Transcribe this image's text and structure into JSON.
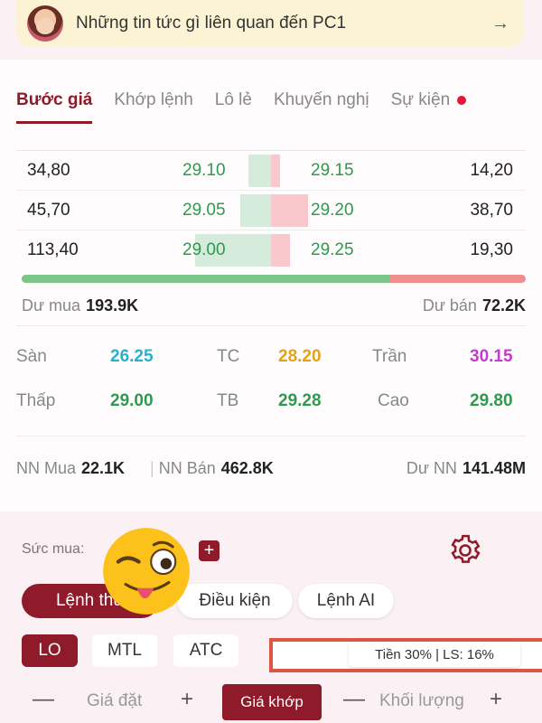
{
  "banner": {
    "text": "Những tin tức gì liên quan đến PC1",
    "arrow": "→"
  },
  "tabs": [
    {
      "label": "Bước giá",
      "active": true
    },
    {
      "label": "Khớp lệnh",
      "active": false
    },
    {
      "label": "Lô lẻ",
      "active": false
    },
    {
      "label": "Khuyến nghị",
      "active": false
    },
    {
      "label": "Sự kiện",
      "active": false,
      "has_dot": true
    }
  ],
  "order_book": [
    {
      "bid_volume": "34,80",
      "bid_price": "29.10",
      "ask_price": "29.15",
      "ask_volume": "14,20",
      "bid_share": 0.18,
      "ask_share": 0.07
    },
    {
      "bid_volume": "45,70",
      "bid_price": "29.05",
      "ask_price": "29.20",
      "ask_volume": "38,70",
      "bid_share": 0.24,
      "ask_share": 0.29
    },
    {
      "bid_volume": "113,40",
      "bid_price": "29.00",
      "ask_price": "29.25",
      "ask_volume": "19,30",
      "bid_share": 0.6,
      "ask_share": 0.15
    }
  ],
  "balance": {
    "buy_fraction": 0.73
  },
  "du_mua": {
    "label": "Dư mua",
    "value": "193.9K"
  },
  "du_ban": {
    "label": "Dư bán",
    "value": "72.2K"
  },
  "stats": {
    "san": {
      "label": "Sàn",
      "value": "26.25"
    },
    "tc": {
      "label": "TC",
      "value": "28.20"
    },
    "tran": {
      "label": "Trần",
      "value": "30.15"
    },
    "thap": {
      "label": "Thấp",
      "value": "29.00"
    },
    "tb": {
      "label": "TB",
      "value": "29.28"
    },
    "cao": {
      "label": "Cao",
      "value": "29.80"
    }
  },
  "colors": {
    "accent": "#8e1a2a",
    "up": "#2f9a4d",
    "ref": "#e3a21a",
    "floor": "#2bb0c9",
    "ceiling": "#c63ad0"
  },
  "foreign": {
    "buy": {
      "label": "NN Mua",
      "value": "22.1K"
    },
    "sell": {
      "label": "NN Bán",
      "value": "462.8K"
    },
    "room": {
      "label": "Dư NN",
      "value": "141.48M"
    }
  },
  "purchase_power": {
    "label": "Sức mua:"
  },
  "order_types": [
    "Lệnh thư",
    "Điều kiện",
    "Lệnh AI"
  ],
  "price_types": [
    "LO",
    "MTL",
    "ATC"
  ],
  "margin_info": "Tiền 30% | LS: 16%",
  "inputs": {
    "price_label": "Giá đặt",
    "match_button": "Giá khớp",
    "volume_label": "Khối lượng",
    "minus": "—",
    "plus": "+"
  },
  "icons": {
    "settings": "gear-icon",
    "emoji": "winking-tongue-emoji"
  }
}
